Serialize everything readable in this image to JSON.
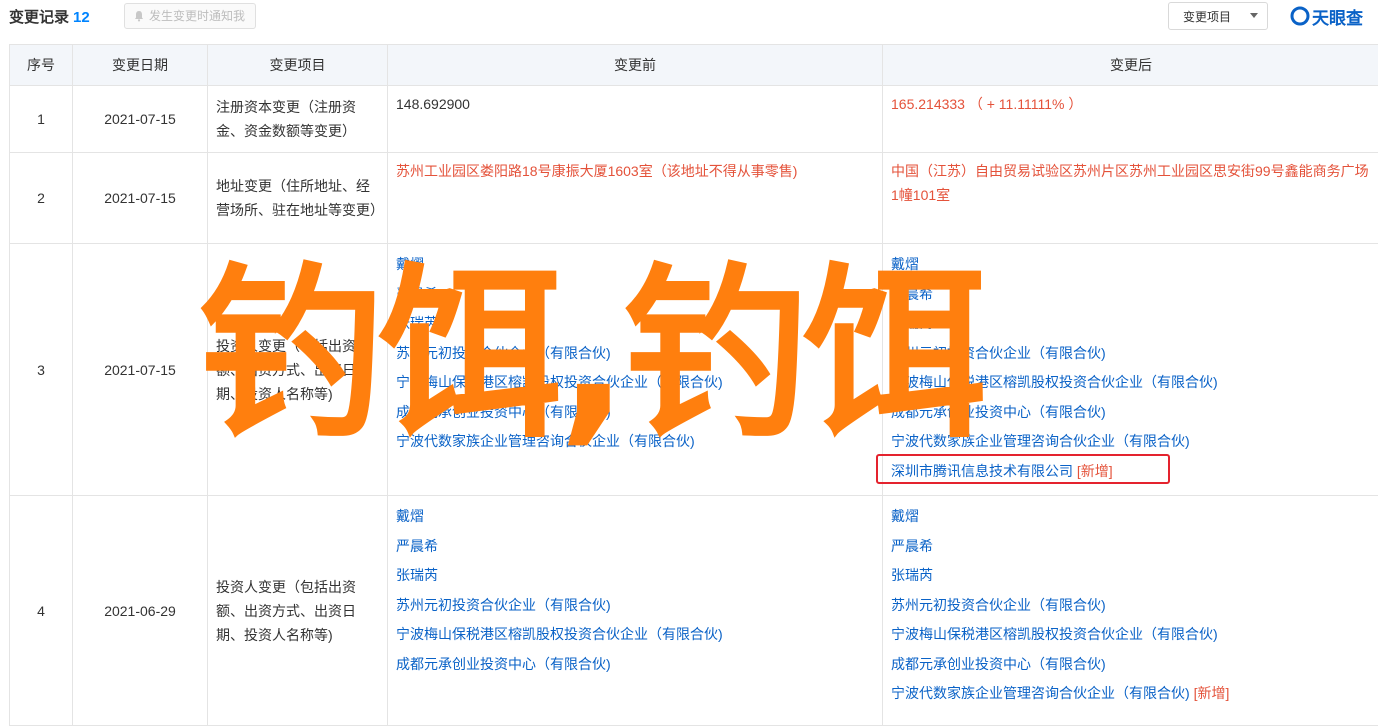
{
  "header": {
    "title": "变更记录",
    "count": "12",
    "notify_label": "发生变更时通知我",
    "filter_label": "变更项目",
    "logo_text": "天眼查"
  },
  "table": {
    "columns": [
      "序号",
      "变更日期",
      "变更项目",
      "变更前",
      "变更后"
    ],
    "rows": [
      {
        "index": "1",
        "date": "2021-07-15",
        "item": "注册资本变更（注册资金、资金数额等变更）",
        "before": "148.692900",
        "after": "165.214333 （ + 11.11111% ）"
      },
      {
        "index": "2",
        "date": "2021-07-15",
        "item": "地址变更（住所地址、经营场所、驻在地址等变更）",
        "before": "苏州工业园区娄阳路18号康振大厦1603室（该地址不得从事零售)",
        "after": "中国（江苏）自由贸易试验区苏州片区苏州工业园区思安街99号鑫能商务广场1幢101室"
      },
      {
        "index": "3",
        "date": "2021-07-15",
        "item": "投资人变更（包括出资额、出资方式、出资日期、投资人名称等)",
        "before_list": [
          "戴熠",
          "严晨希",
          "张瑞芮",
          "苏州元初投资合伙企业（有限合伙)",
          "宁波梅山保税港区榕凯股权投资合伙企业（有限合伙)",
          "成都元承创业投资中心（有限合伙)",
          "宁波代数家族企业管理咨询合伙企业（有限合伙)"
        ],
        "after_list": [
          "戴熠",
          "严晨希",
          "张瑞芮",
          "苏州元初投资合伙企业（有限合伙)",
          "宁波梅山保税港区榕凯股权投资合伙企业（有限合伙)",
          "成都元承创业投资中心（有限合伙)",
          "宁波代数家族企业管理咨询合伙企业（有限合伙)",
          "深圳市腾讯信息技术有限公司"
        ],
        "new_tag": "[新增]"
      },
      {
        "index": "4",
        "date": "2021-06-29",
        "item": "投资人变更（包括出资额、出资方式、出资日期、投资人名称等)",
        "before_list": [
          "戴熠",
          "严晨希",
          "张瑞芮",
          "苏州元初投资合伙企业（有限合伙)",
          "宁波梅山保税港区榕凯股权投资合伙企业（有限合伙)",
          "成都元承创业投资中心（有限合伙)"
        ],
        "after_list": [
          "戴熠",
          "严晨希",
          "张瑞芮",
          "苏州元初投资合伙企业（有限合伙)",
          "宁波梅山保税港区榕凯股权投资合伙企业（有限合伙)",
          "成都元承创业投资中心（有限合伙)",
          "宁波代数家族企业管理咨询合伙企业（有限合伙)"
        ],
        "new_tag": "[新增]"
      }
    ]
  },
  "overlay_text": "钓饵,钓饵",
  "colors": {
    "link": "#0a62c7",
    "red": "#e4523a",
    "accent_count": "#0084ff",
    "overlay": "#ff7f0e",
    "highlight_box": "#e4232e"
  }
}
